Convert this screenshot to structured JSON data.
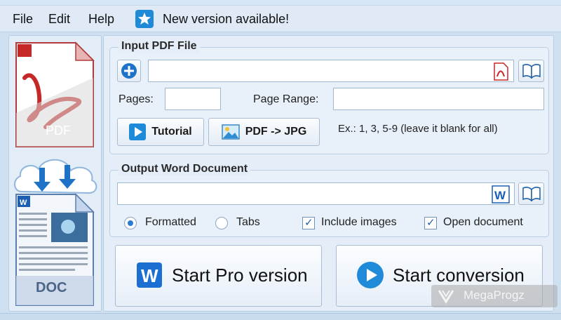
{
  "menu": {
    "file": "File",
    "edit": "Edit",
    "help": "Help",
    "notice": "New version available!"
  },
  "left_panel": {
    "pdf_label": "PDF",
    "doc_label": "DOC"
  },
  "input_group": {
    "title": "Input PDF File",
    "file_value": "",
    "pages_label": "Pages:",
    "pages_value": "",
    "page_range_label": "Page Range:",
    "page_range_value": "",
    "tutorial_label": "Tutorial",
    "pdf_jpg_label": "PDF -> JPG",
    "hint": "Ex.: 1, 3, 5-9  (leave it blank for all)"
  },
  "output_group": {
    "title": "Output Word Document",
    "file_value": "",
    "formatted_label": "Formatted",
    "tabs_label": "Tabs",
    "include_images_label": "Include images",
    "open_document_label": "Open document",
    "formatted_selected": true,
    "tabs_selected": false,
    "include_images_checked": true,
    "open_document_checked": true
  },
  "actions": {
    "start_pro_label": "Start Pro version",
    "start_conversion_label": "Start conversion"
  },
  "watermark": "MegaProgz",
  "colors": {
    "accent": "#1e8ad8",
    "pdf_red": "#c62828",
    "word_blue": "#1a5fb4"
  }
}
